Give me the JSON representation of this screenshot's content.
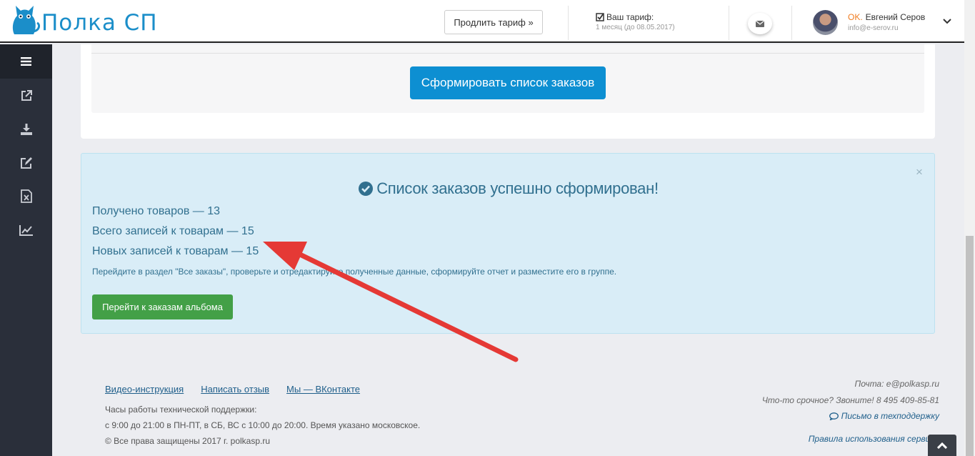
{
  "header": {
    "logo_text": "Полка СП",
    "extend_button": "Продлить тариф »",
    "tariff_label": "Ваш тариф:",
    "tariff_value": "1 месяц (до 08.05.2017)",
    "user_status": "OK.",
    "user_name": "Евгений Серов",
    "user_email": "info@e-serov.ru"
  },
  "sidebar": {
    "icons": [
      "menu-icon",
      "external-link-icon",
      "download-icon",
      "edit-icon",
      "excel-file-icon",
      "chart-line-icon"
    ]
  },
  "main": {
    "form_button": "Сформировать список заказов"
  },
  "success": {
    "title": "Список заказов успешно сформирован!",
    "stats": [
      "Получено товаров — 13",
      "Всего записей к товарам — 15",
      "Новых записей к товарам — 15"
    ],
    "hint": "Перейдите в раздел \"Все заказы\", проверьте и отредактируйте полученные данные, сформируйте отчет и разместите его в группе.",
    "go_button": "Перейти к заказам альбома",
    "close": "×"
  },
  "footer": {
    "links": [
      "Видео-инструкция",
      "Написать отзыв",
      "Мы — ВКонтакте"
    ],
    "support_hours_1": "Часы работы технической поддержки:",
    "support_hours_2": "с 9:00 до 21:00 в ПН-ПТ, в СБ, ВС с 10:00 до 20:00. Время указано московское.",
    "copyright": "© Все права защищены 2017 г. polkasp.ru",
    "email": "Почта: e@polkasp.ru",
    "phone": "Что-то срочное? Звоните! 8 495 409-85-81",
    "support_link": "Письмо в техподдержку",
    "rules_link": "Правила использования сервиса"
  },
  "colors": {
    "brand": "#1b8ec9",
    "primary_button": "#0d8fd2",
    "success_button": "#43a047",
    "alert_text": "#31708f",
    "alert_bg": "#d9edf7",
    "annotation_arrow": "#e53935"
  }
}
